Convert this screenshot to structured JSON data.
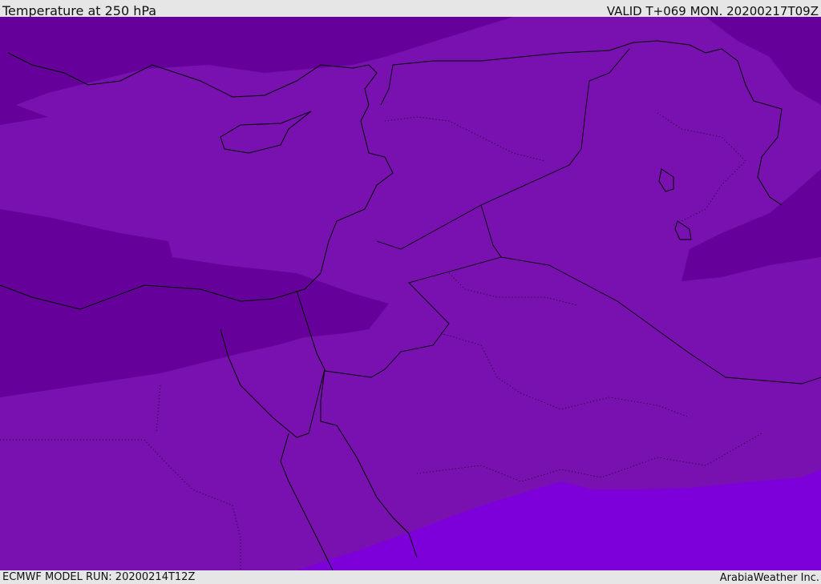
{
  "header": {
    "title": "Temperature at 250 hPa",
    "valid": "VALID T+069 MON. 20200217T09Z"
  },
  "footer": {
    "model_run": "ECMWF MODEL RUN: 20200214T12Z",
    "credit": "ArabiaWeather Inc."
  },
  "colors": {
    "base": "#7911b1",
    "cold": "#65009a",
    "warm": "#7d00da",
    "background": "#e6e6e6"
  }
}
